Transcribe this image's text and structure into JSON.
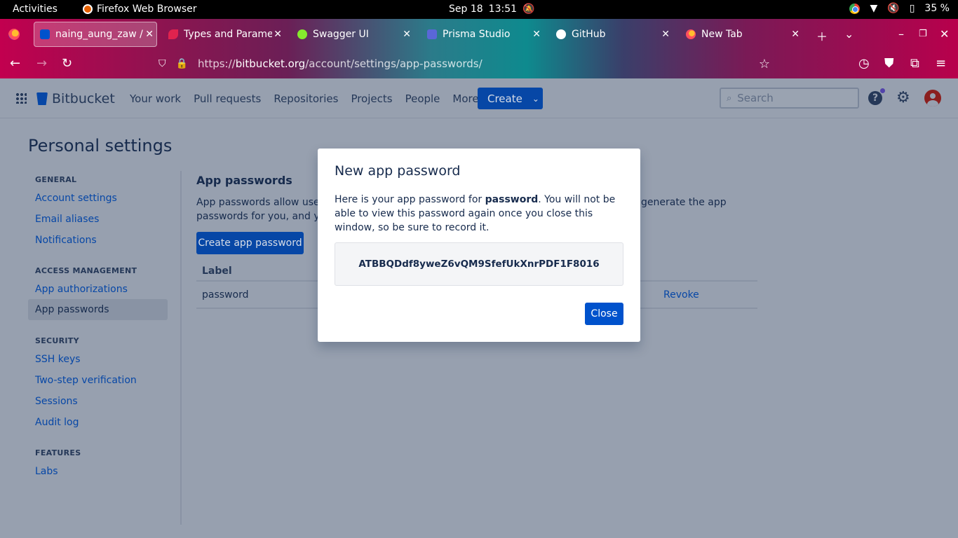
{
  "system_bar": {
    "activities": "Activities",
    "app_name": "Firefox Web Browser",
    "date": "Sep 18",
    "time": "13:51",
    "battery": "35 %"
  },
  "tabs": [
    {
      "label": "naing_aung_zaw / a",
      "active": true,
      "color": "#0052cc"
    },
    {
      "label": "Types and Paramet",
      "active": false,
      "color": "#e0234e"
    },
    {
      "label": "Swagger UI",
      "active": false,
      "color": "#85ea2d"
    },
    {
      "label": "Prisma Studio",
      "active": false,
      "color": "#5a67d8"
    },
    {
      "label": "GitHub",
      "active": false,
      "color": "#ffffff"
    },
    {
      "label": "New Tab",
      "active": false,
      "color": "#ff7139"
    }
  ],
  "url": {
    "prefix": "https://",
    "host": "bitbucket.org",
    "path": "/account/settings/app-passwords/"
  },
  "bbnav": {
    "logo": "Bitbucket",
    "links": [
      "Your work",
      "Pull requests",
      "Repositories",
      "Projects",
      "People",
      "More"
    ],
    "create": "Create",
    "search_placeholder": "Search"
  },
  "page": {
    "title": "Personal settings",
    "sidebar": {
      "general_header": "GENERAL",
      "account_settings": "Account settings",
      "email_aliases": "Email aliases",
      "notifications": "Notifications",
      "access_header": "ACCESS MANAGEMENT",
      "app_authorizations": "App authorizations",
      "app_passwords": "App passwords",
      "security_header": "SECURITY",
      "ssh_keys": "SSH keys",
      "two_step": "Two-step verification",
      "sessions": "Sessions",
      "audit_log": "Audit log",
      "features_header": "FEATURES",
      "labs": "Labs"
    },
    "content": {
      "heading": "App passwords",
      "desc_line1_left": "App passwords allow users",
      "desc_line1_right": "generate the app",
      "desc_line2": "passwords for you, and you",
      "create_button": "Create app password",
      "col_label": "Label",
      "row_label": "password",
      "revoke": "Revoke"
    }
  },
  "modal": {
    "title": "New app password",
    "body_prefix": "Here is your app password for ",
    "body_bold": "password",
    "body_suffix": ". You will not be able to view this password again once you close this window, so be sure to record it.",
    "password": "ATBBQDdf8yweZ6vQM9SfefUkXnrPDF1F8016",
    "close": "Close"
  }
}
